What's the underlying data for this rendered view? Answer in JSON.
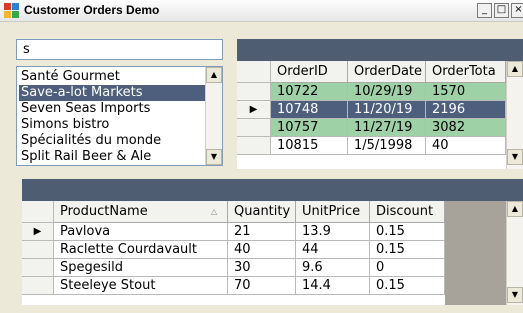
{
  "window": {
    "title": "Customer Orders Demo",
    "controls": {
      "minimize": "_",
      "maximize": "□",
      "close": "×"
    }
  },
  "search": {
    "value": "s"
  },
  "customers": {
    "items": [
      {
        "label": "Santé Gourmet"
      },
      {
        "label": "Save-a-lot Markets",
        "selected": true
      },
      {
        "label": "Seven Seas Imports"
      },
      {
        "label": "Simons bistro"
      },
      {
        "label": "Spécialités du monde"
      },
      {
        "label": "Split Rail Beer & Ale"
      }
    ],
    "scroll": {
      "up": "▲",
      "down": "▼"
    }
  },
  "orders": {
    "columns": [
      "OrderID",
      "OrderDate",
      "OrderTota"
    ],
    "rows": [
      {
        "indicator": "",
        "cells": [
          "10722",
          "10/29/19",
          "1570"
        ],
        "state": "green"
      },
      {
        "indicator": "▶",
        "cells": [
          "10748",
          "11/20/19",
          "2196"
        ],
        "state": "selected"
      },
      {
        "indicator": "",
        "cells": [
          "10757",
          "11/27/19",
          "3082"
        ],
        "state": "green"
      },
      {
        "indicator": "",
        "cells": [
          "10815",
          "1/5/1998",
          "40"
        ],
        "state": "normal"
      }
    ],
    "scroll": {
      "up": "▲",
      "down": "▼"
    }
  },
  "details": {
    "columns": [
      "ProductName",
      "Quantity",
      "UnitPrice",
      "Discount"
    ],
    "sort_glyph": "△",
    "rows": [
      {
        "indicator": "▶",
        "cells": [
          "Pavlova",
          "21",
          "13.9",
          "0.15"
        ]
      },
      {
        "indicator": "",
        "cells": [
          "Raclette Courdavault",
          "40",
          "44",
          "0.15"
        ]
      },
      {
        "indicator": "",
        "cells": [
          "Spegesild",
          "30",
          "9.6",
          "0"
        ]
      },
      {
        "indicator": "",
        "cells": [
          "Steeleye Stout",
          "70",
          "14.4",
          "0.15"
        ]
      }
    ],
    "scroll": {
      "up": "▲",
      "down": "▼"
    }
  },
  "colors": {
    "caption": "#4f5d72",
    "selection": "#4d5f7c",
    "alt_row": "#9fd1a6",
    "grid_background": "#a7a39a"
  }
}
